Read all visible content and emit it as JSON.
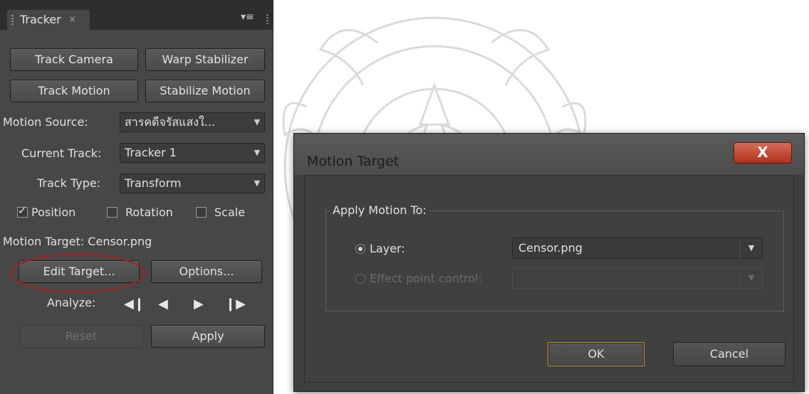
{
  "tracker": {
    "tab_label": "Tracker",
    "tab_close": "×",
    "panel_menu": "▾≡",
    "buttons": {
      "track_camera": "Track Camera",
      "warp_stabilizer": "Warp Stabilizer",
      "track_motion": "Track Motion",
      "stabilize_motion": "Stabilize Motion"
    },
    "motion_source_label": "Motion Source:",
    "motion_source_value": "สารคดีจรัสแสงใ...",
    "current_track_label": "Current Track:",
    "current_track_value": "Tracker 1",
    "track_type_label": "Track Type:",
    "track_type_value": "Transform",
    "position_label": "Position",
    "rotation_label": "Rotation",
    "scale_label": "Scale",
    "position_checked": true,
    "rotation_checked": false,
    "scale_checked": false,
    "motion_target_text": "Motion Target: Censor.png",
    "edit_target_label": "Edit Target...",
    "options_label": "Options...",
    "analyze_label": "Analyze:",
    "reset_label": "Reset",
    "apply_label": "Apply"
  },
  "dialog": {
    "title": "Motion Target",
    "close_glyph": "X",
    "group_title": "Apply Motion To:",
    "layer_label": "Layer:",
    "layer_value": "Censor.png",
    "effect_point_label": "Effect point control:",
    "ok_label": "OK",
    "cancel_label": "Cancel"
  },
  "colors": {
    "panel_bg": "#474747",
    "dialog_bg": "#404040",
    "highlight": "#8c2a2a",
    "close_button": "#c0432c",
    "default_button_border": "#c99a2e"
  }
}
